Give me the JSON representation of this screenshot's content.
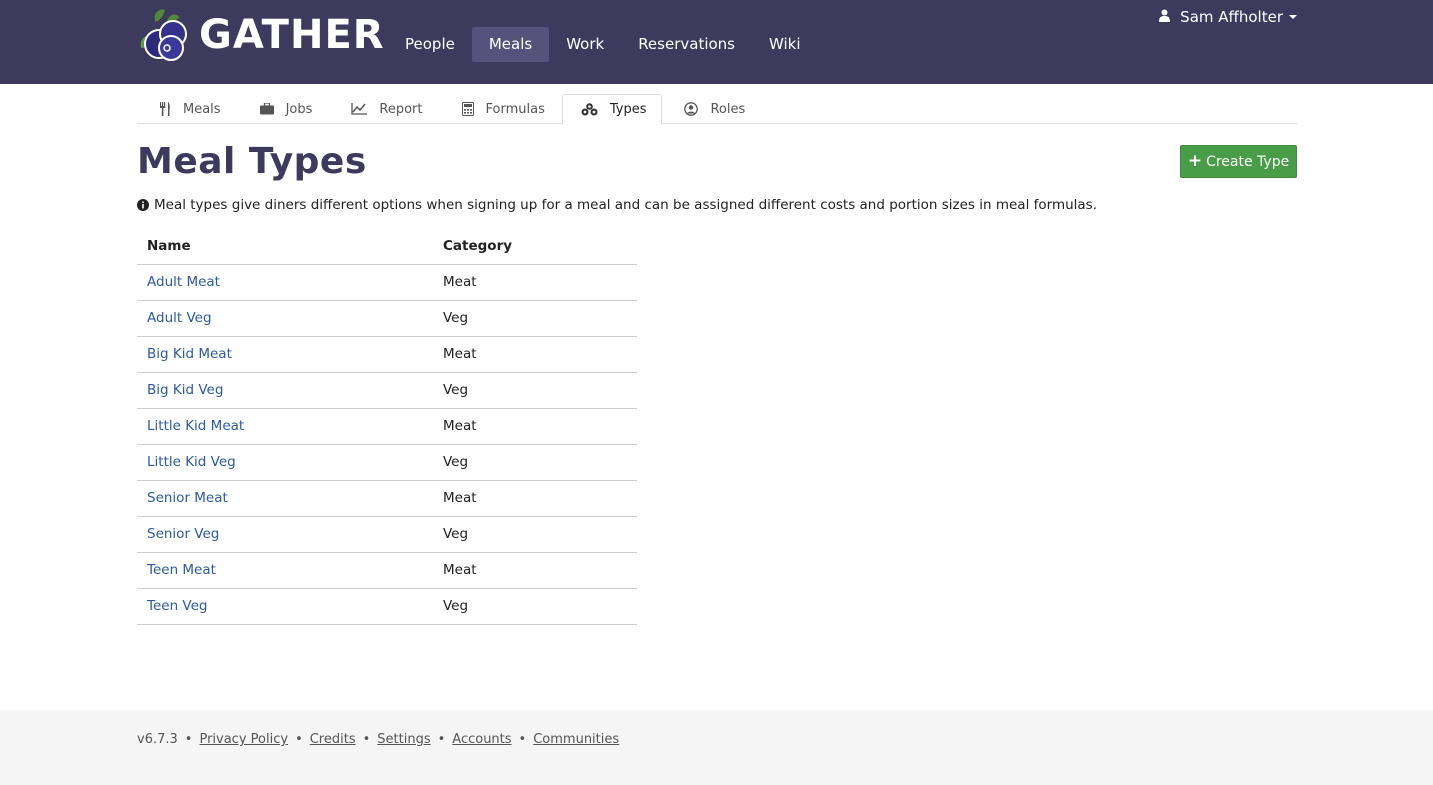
{
  "brand": {
    "name": "GATHER"
  },
  "nav": {
    "items": [
      {
        "label": "People"
      },
      {
        "label": "Meals"
      },
      {
        "label": "Work"
      },
      {
        "label": "Reservations"
      },
      {
        "label": "Wiki"
      }
    ],
    "active": "Meals"
  },
  "user": {
    "name": "Sam Affholter"
  },
  "subtabs": [
    {
      "label": "Meals",
      "icon": "cutlery-icon"
    },
    {
      "label": "Jobs",
      "icon": "briefcase-icon"
    },
    {
      "label": "Report",
      "icon": "line-chart-icon"
    },
    {
      "label": "Formulas",
      "icon": "calculator-icon"
    },
    {
      "label": "Types",
      "icon": "cubes-icon"
    },
    {
      "label": "Roles",
      "icon": "user-circle-icon"
    }
  ],
  "page": {
    "title": "Meal Types",
    "create_label": "Create Type",
    "info": "Meal types give diners different options when signing up for a meal and can be assigned different costs and portion sizes in meal formulas."
  },
  "table": {
    "headers": [
      "Name",
      "Category"
    ],
    "rows": [
      {
        "name": "Adult Meat",
        "category": "Meat"
      },
      {
        "name": "Adult Veg",
        "category": "Veg"
      },
      {
        "name": "Big Kid Meat",
        "category": "Meat"
      },
      {
        "name": "Big Kid Veg",
        "category": "Veg"
      },
      {
        "name": "Little Kid Meat",
        "category": "Meat"
      },
      {
        "name": "Little Kid Veg",
        "category": "Veg"
      },
      {
        "name": "Senior Meat",
        "category": "Meat"
      },
      {
        "name": "Senior Veg",
        "category": "Veg"
      },
      {
        "name": "Teen Meat",
        "category": "Meat"
      },
      {
        "name": "Teen Veg",
        "category": "Veg"
      }
    ]
  },
  "footer": {
    "version": "v6.7.3",
    "links": [
      "Privacy Policy",
      "Credits",
      "Settings",
      "Accounts",
      "Communities"
    ]
  },
  "colors": {
    "navbar": "#3d3a5e",
    "nav_active": "#55527c",
    "button_green": "#4a9d48",
    "link_blue": "#2c5aa0"
  }
}
